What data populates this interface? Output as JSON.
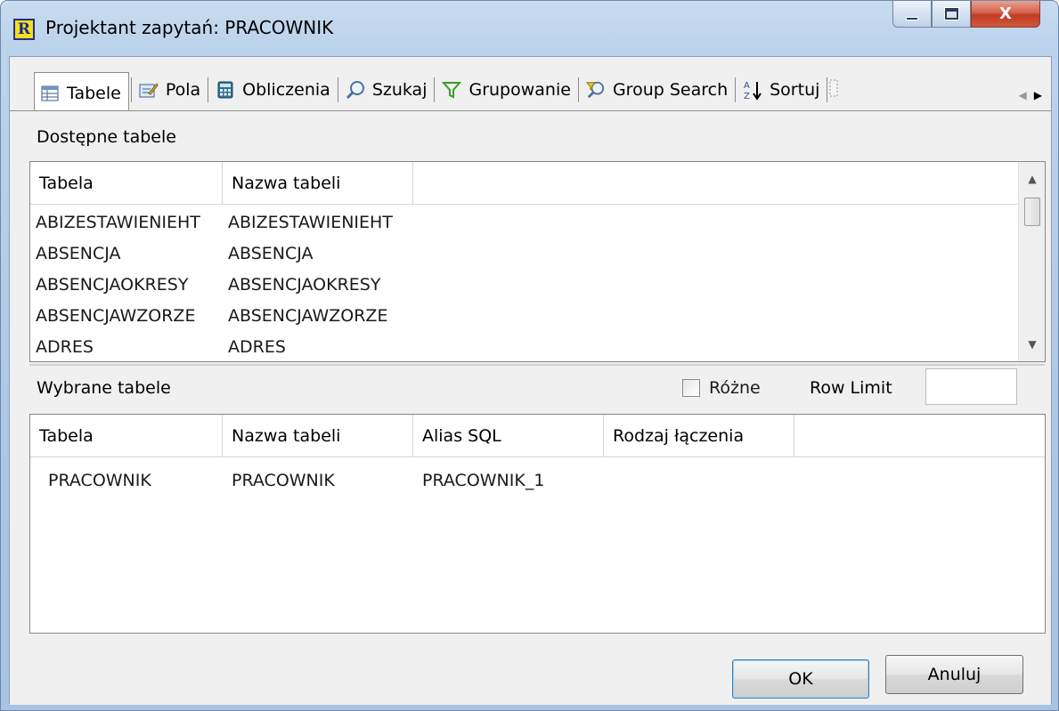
{
  "window": {
    "title": "Projektant zapytań: PRACOWNIK",
    "app_icon_letter": "R",
    "close_glyph": "X"
  },
  "tabs": [
    {
      "label": "Tabele",
      "icon": "table-icon"
    },
    {
      "label": "Pola",
      "icon": "edit-fields-icon"
    },
    {
      "label": "Obliczenia",
      "icon": "calculator-icon"
    },
    {
      "label": "Szukaj",
      "icon": "magnifier-icon"
    },
    {
      "label": "Grupowanie",
      "icon": "funnel-filter-icon"
    },
    {
      "label": "Group Search",
      "icon": "group-search-icon"
    },
    {
      "label": "Sortuj",
      "icon": "sort-az-icon"
    }
  ],
  "available": {
    "label": "Dostępne tabele",
    "columns": [
      "Tabela",
      "Nazwa tabeli"
    ],
    "rows": [
      [
        "ABIZESTAWIENIEHT",
        "ABIZESTAWIENIEHT"
      ],
      [
        "ABSENCJA",
        "ABSENCJA"
      ],
      [
        "ABSENCJAOKRESY",
        "ABSENCJAOKRESY"
      ],
      [
        "ABSENCJAWZORZE",
        "ABSENCJAWZORZE"
      ],
      [
        "ADRES",
        "ADRES"
      ]
    ]
  },
  "selected": {
    "label": "Wybrane tabele",
    "distinct_label": "Różne",
    "distinct_checked": false,
    "row_limit_label": "Row Limit",
    "row_limit_value": "",
    "columns": [
      "Tabela",
      "Nazwa tabeli",
      "Alias SQL",
      "Rodzaj łączenia"
    ],
    "rows": [
      [
        "PRACOWNIK",
        "PRACOWNIK",
        "PRACOWNIK_1",
        ""
      ]
    ]
  },
  "buttons": {
    "ok": "OK",
    "cancel": "Anuluj"
  },
  "colors": {
    "title_bar": "#bcd3ec",
    "close_button": "#c94a32",
    "dialog_bg": "#f0f0f0"
  }
}
